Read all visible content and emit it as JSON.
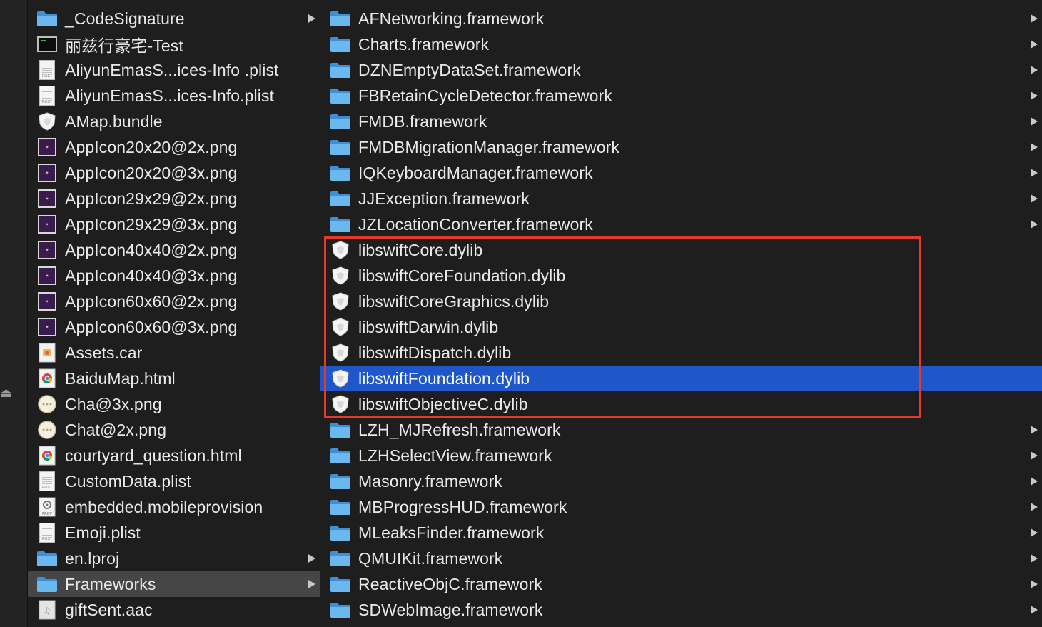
{
  "column1": {
    "items": [
      {
        "name": "_CodeSignature",
        "icon": "folder-icon",
        "folder": true
      },
      {
        "name": "丽兹行豪宅-Test",
        "icon": "executable-icon",
        "folder": false
      },
      {
        "name": "AliyunEmasS...ices-Info .plist",
        "icon": "plist-icon",
        "folder": false
      },
      {
        "name": "AliyunEmasS...ices-Info.plist",
        "icon": "plist-icon",
        "folder": false
      },
      {
        "name": "AMap.bundle",
        "icon": "bundle-icon",
        "folder": false
      },
      {
        "name": "AppIcon20x20@2x.png",
        "icon": "image-thumbnail-icon",
        "folder": false
      },
      {
        "name": "AppIcon20x20@3x.png",
        "icon": "image-thumbnail-icon",
        "folder": false
      },
      {
        "name": "AppIcon29x29@2x.png",
        "icon": "image-thumbnail-icon",
        "folder": false
      },
      {
        "name": "AppIcon29x29@3x.png",
        "icon": "image-thumbnail-icon",
        "folder": false
      },
      {
        "name": "AppIcon40x40@2x.png",
        "icon": "image-thumbnail-icon",
        "folder": false
      },
      {
        "name": "AppIcon40x40@3x.png",
        "icon": "image-thumbnail-icon",
        "folder": false
      },
      {
        "name": "AppIcon60x60@2x.png",
        "icon": "image-thumbnail-icon",
        "folder": false
      },
      {
        "name": "AppIcon60x60@3x.png",
        "icon": "image-thumbnail-icon",
        "folder": false
      },
      {
        "name": "Assets.car",
        "icon": "asset-catalog-icon",
        "folder": false
      },
      {
        "name": "BaiduMap.html",
        "icon": "chrome-html-icon",
        "folder": false
      },
      {
        "name": "Cha@3x.png",
        "icon": "chat-bubble-icon",
        "folder": false
      },
      {
        "name": "Chat@2x.png",
        "icon": "chat-bubble-icon",
        "folder": false
      },
      {
        "name": "courtyard_question.html",
        "icon": "chrome-html-icon",
        "folder": false
      },
      {
        "name": "CustomData.plist",
        "icon": "plist-icon",
        "folder": false
      },
      {
        "name": "embedded.mobileprovision",
        "icon": "provision-icon",
        "folder": false
      },
      {
        "name": "Emoji.plist",
        "icon": "plist-icon",
        "folder": false
      },
      {
        "name": "en.lproj",
        "icon": "folder-icon",
        "folder": true
      },
      {
        "name": "Frameworks",
        "icon": "folder-icon",
        "folder": true,
        "selected": true
      },
      {
        "name": "giftSent.aac",
        "icon": "audio-file-icon",
        "folder": false
      }
    ]
  },
  "column2": {
    "items": [
      {
        "name": "AFNetworking.framework",
        "icon": "folder-icon",
        "folder": true
      },
      {
        "name": "Charts.framework",
        "icon": "folder-icon",
        "folder": true
      },
      {
        "name": "DZNEmptyDataSet.framework",
        "icon": "folder-icon",
        "folder": true
      },
      {
        "name": "FBRetainCycleDetector.framework",
        "icon": "folder-icon",
        "folder": true
      },
      {
        "name": "FMDB.framework",
        "icon": "folder-icon",
        "folder": true
      },
      {
        "name": "FMDBMigrationManager.framework",
        "icon": "folder-icon",
        "folder": true
      },
      {
        "name": "IQKeyboardManager.framework",
        "icon": "folder-icon",
        "folder": true
      },
      {
        "name": "JJException.framework",
        "icon": "folder-icon",
        "folder": true
      },
      {
        "name": "JZLocationConverter.framework",
        "icon": "folder-icon",
        "folder": true
      },
      {
        "name": "libswiftCore.dylib",
        "icon": "dylib-shield-icon",
        "folder": false
      },
      {
        "name": "libswiftCoreFoundation.dylib",
        "icon": "dylib-shield-icon",
        "folder": false
      },
      {
        "name": "libswiftCoreGraphics.dylib",
        "icon": "dylib-shield-icon",
        "folder": false
      },
      {
        "name": "libswiftDarwin.dylib",
        "icon": "dylib-shield-icon",
        "folder": false
      },
      {
        "name": "libswiftDispatch.dylib",
        "icon": "dylib-shield-icon",
        "folder": false
      },
      {
        "name": "libswiftFoundation.dylib",
        "icon": "dylib-shield-icon",
        "folder": false,
        "selected": true
      },
      {
        "name": "libswiftObjectiveC.dylib",
        "icon": "dylib-shield-icon",
        "folder": false
      },
      {
        "name": "LZH_MJRefresh.framework",
        "icon": "folder-icon",
        "folder": true
      },
      {
        "name": "LZHSelectView.framework",
        "icon": "folder-icon",
        "folder": true
      },
      {
        "name": "Masonry.framework",
        "icon": "folder-icon",
        "folder": true
      },
      {
        "name": "MBProgressHUD.framework",
        "icon": "folder-icon",
        "folder": true
      },
      {
        "name": "MLeaksFinder.framework",
        "icon": "folder-icon",
        "folder": true
      },
      {
        "name": "QMUIKit.framework",
        "icon": "folder-icon",
        "folder": true
      },
      {
        "name": "ReactiveObjC.framework",
        "icon": "folder-icon",
        "folder": true
      },
      {
        "name": "SDWebImage.framework",
        "icon": "folder-icon",
        "folder": true
      }
    ]
  },
  "colors": {
    "background": "#1e1e1e",
    "selection_blue": "#1f56c9",
    "selection_gray": "#464646",
    "folder_blue": "#5aaee8",
    "highlight_red": "#e23b2a",
    "text": "#e9e9e9"
  }
}
